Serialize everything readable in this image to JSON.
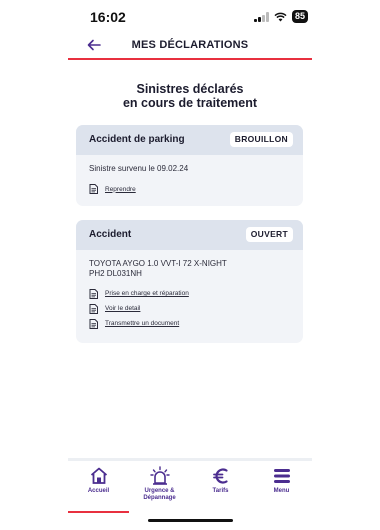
{
  "status_bar": {
    "time": "16:02",
    "battery": "85"
  },
  "header": {
    "title": "MES DÉCLARATIONS"
  },
  "section": {
    "title_line1": "Sinistres déclarés",
    "title_line2": "en cours de traitement"
  },
  "cards": [
    {
      "title": "Accident de parking",
      "badge": "BROUILLON",
      "text": "Sinistre survenu le 09.02.24",
      "actions": [
        "Reprendre"
      ]
    },
    {
      "title": "Accident",
      "badge": "OUVERT",
      "text_line1": "TOYOTA AYGO 1.0 VVT-I 72 X-NIGHT",
      "text_line2": "PH2 DL031NH",
      "actions": [
        "Prise en charge et réparation",
        "Voir le detail",
        "Transmettre un document"
      ]
    }
  ],
  "nav": {
    "items": [
      {
        "label": "Accueil",
        "icon": "home-icon"
      },
      {
        "label_line1": "Urgence &",
        "label_line2": "Dépannage",
        "icon": "emergency-icon"
      },
      {
        "label": "Tarifs",
        "icon": "euro-icon"
      },
      {
        "label": "Menu",
        "icon": "menu-icon"
      }
    ],
    "active": "Accueil"
  },
  "colors": {
    "accent_red": "#e8303f",
    "brand_purple": "#4b2d8f",
    "card_head": "#dde3ed",
    "card_bg": "#f2f4f8"
  }
}
